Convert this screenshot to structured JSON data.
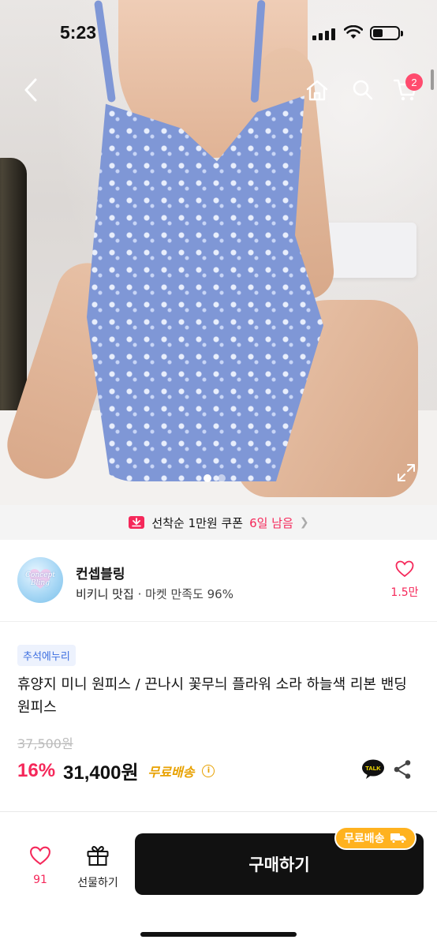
{
  "status_bar": {
    "time": "5:23"
  },
  "header": {
    "cart_count": "2"
  },
  "gallery": {
    "page_count": 2,
    "current_page": 1
  },
  "coupon_banner": {
    "text": "선착순 1만원 쿠폰",
    "highlight": "6일 남음"
  },
  "shop": {
    "logo_text": "Concept Bling",
    "name": "컨셉블링",
    "category": "비키니 맛집",
    "satisfaction": "· 마켓 만족도 96%",
    "likes": "1.5만"
  },
  "product": {
    "tag": "추석에누리",
    "title": "휴양지 미니 원피스 / 끈나시 꽃무늬 플라워 소라 하늘색 리본 밴딩 원피스",
    "original_price": "37,500원",
    "discount": "16%",
    "price": "31,400원",
    "shipping": "무료배송",
    "talk_label": "TALK"
  },
  "bottom_bar": {
    "wish_count": "91",
    "gift_label": "선물하기",
    "buy_label": "구매하기",
    "free_shipping_badge": "무료배송"
  },
  "colors": {
    "accent": "#f5285a",
    "shipping": "#e8a100",
    "tag_bg": "#edf2fd",
    "tag_text": "#3c6ee0",
    "buy_button": "#111111"
  }
}
